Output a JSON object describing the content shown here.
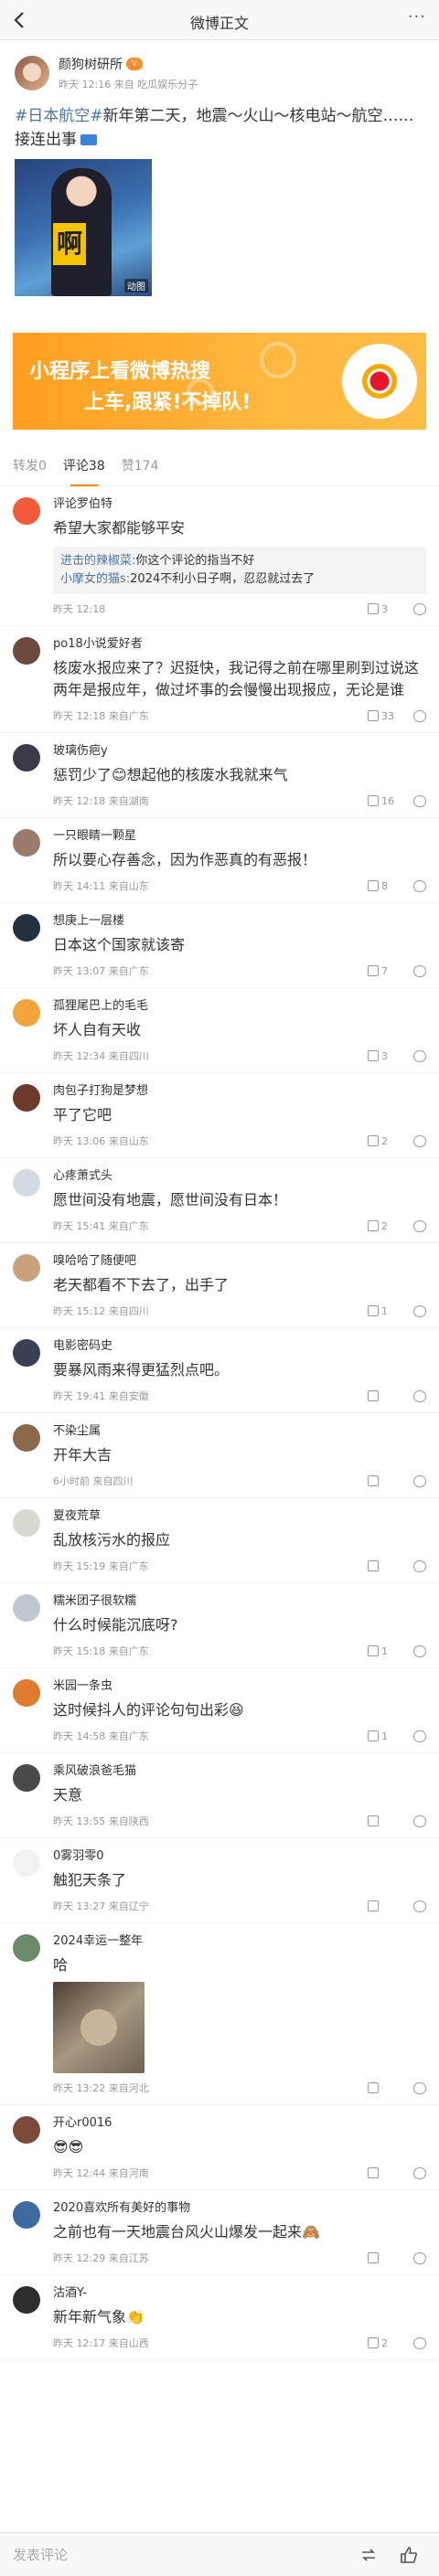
{
  "nav": {
    "title": "微博正文",
    "more": "···"
  },
  "post": {
    "author": "颜狗树研所",
    "vip": "V",
    "meta": "昨天 12:16 来自 吃瓜娱乐分子",
    "topic": "#日本航空#",
    "text": "新年第二天，地震～火山～核电站～航空……接连出事",
    "media_badge": "动图",
    "media_sign": "啊"
  },
  "banner": {
    "line1": "小程序上看微博热搜",
    "line2": "上车,跟紧!不掉队!"
  },
  "tabs": [
    {
      "label": "转发0"
    },
    {
      "label": "评论38"
    },
    {
      "label": "赞174"
    }
  ],
  "comments": [
    {
      "name": "评论罗伯特",
      "text": "希望大家都能够平安",
      "time": "昨天 12:18",
      "likes": "3",
      "replies": [
        {
          "user": "进击的辣椒菜:",
          "text": "你这个评论的指当不好"
        },
        {
          "user": "小摩女的猫s:",
          "text": "2024不利小日子啊，忍忍就过去了"
        }
      ]
    },
    {
      "name": "po18小说爱好者",
      "text": "核废水报应来了？迟挺快，我记得之前在哪里刷到过说这两年是报应年，做过坏事的会慢慢出现报应，无论是谁",
      "time": "昨天 12:18 来自广东",
      "likes": "33"
    },
    {
      "name": "玻璃伤疤y",
      "text": "惩罚少了😊想起他的核废水我就来气",
      "time": "昨天 12:18 来自湖南",
      "likes": "16"
    },
    {
      "name": "一只眼睛一颗星",
      "text": "所以要心存善念，因为作恶真的有恶报！",
      "time": "昨天 14:11 来自山东",
      "likes": "8"
    },
    {
      "name": "想庚上一层楼",
      "text": "日本这个国家就该寄",
      "time": "昨天 13:07 来自广东",
      "likes": "7"
    },
    {
      "name": "孤狸尾巴上的毛毛",
      "text": "坏人自有天收",
      "time": "昨天 12:34 来自四川",
      "likes": "3"
    },
    {
      "name": "肉包子打狗是梦想",
      "text": "平了它吧",
      "time": "昨天 13:06 来自山东",
      "likes": "2"
    },
    {
      "name": "心疼萧式头",
      "text": "愿世间没有地震，愿世间没有日本！",
      "time": "昨天 15:41 来自广东",
      "likes": "2"
    },
    {
      "name": "嗅哈哈了随便吧",
      "text": "老天都看不下去了，出手了",
      "time": "昨天 15:12 来自四川",
      "likes": "1"
    },
    {
      "name": "电影密码史",
      "text": "要暴风雨来得更猛烈点吧。",
      "time": "昨天 19:41 来自安徽",
      "likes": ""
    },
    {
      "name": "不染尘属",
      "text": "开年大吉",
      "time": "6小时前 来自四川",
      "likes": ""
    },
    {
      "name": "夏夜荒草",
      "text": "乱放核污水的报应",
      "time": "昨天 15:19 来自广东",
      "likes": ""
    },
    {
      "name": "糯米团子很软糯",
      "text": "什么时候能沉底呀?",
      "time": "昨天 15:18 来自广东",
      "likes": "1"
    },
    {
      "name": "米园一条虫",
      "text": "这时候抖人的评论句句出彩😆",
      "time": "昨天 14:58 来自广东",
      "likes": "1"
    },
    {
      "name": "乘风破浪爸毛猫",
      "text": "天意",
      "time": "昨天 13:55 来自陕西",
      "likes": ""
    },
    {
      "name": "0雾羽零0",
      "text": "触犯天条了",
      "time": "昨天 13:27 来自辽宁",
      "likes": ""
    },
    {
      "name": "2024幸运一整年",
      "text": "哈",
      "time": "昨天 13:22 来自河北",
      "likes": "",
      "image": true
    },
    {
      "name": "开心r0016",
      "text": "😎😎",
      "time": "昨天 12:44 来自河南",
      "likes": ""
    },
    {
      "name": "2020喜欢所有美好的事物",
      "text": "之前也有一天地震台风火山爆发一起来🙈",
      "time": "昨天 12:29 来自江苏",
      "likes": ""
    },
    {
      "name": "沽酒Y-",
      "text": "新年新气象👏",
      "time": "昨天 12:17 来自山西",
      "likes": "2"
    }
  ],
  "bottombar": {
    "placeholder": "发表评论"
  },
  "colors": {
    "accent": "#ff8200",
    "link": "#4c74a7",
    "banner": "#ffb63d"
  }
}
